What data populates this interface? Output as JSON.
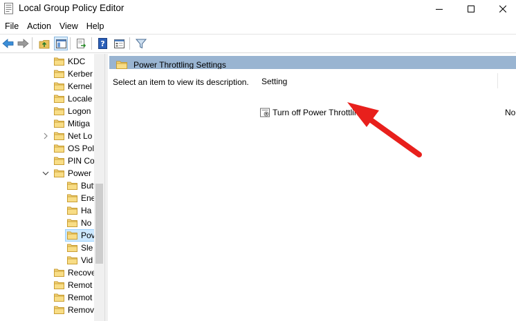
{
  "window": {
    "title": "Local Group Policy Editor",
    "icon": "policy-editor-icon",
    "controls": [
      "minimize-icon",
      "maximize-icon",
      "close-icon"
    ]
  },
  "menu": [
    "File",
    "Action",
    "View",
    "Help"
  ],
  "toolbar": [
    "back-arrow-icon",
    "forward-arrow-icon",
    "up-folder-icon",
    "show-hide-tree-icon",
    "export-list-icon",
    "help-icon",
    "properties-icon",
    "filter-icon"
  ],
  "tree": {
    "items": [
      {
        "label": "KDC",
        "expandable": false
      },
      {
        "label": "Kerber",
        "expandable": false
      },
      {
        "label": "Kernel",
        "expandable": false
      },
      {
        "label": "Locale",
        "expandable": false
      },
      {
        "label": "Logon",
        "expandable": false
      },
      {
        "label": "Mitiga",
        "expandable": false
      },
      {
        "label": "Net Lo",
        "expandable": true
      },
      {
        "label": "OS Pol",
        "expandable": false
      },
      {
        "label": "PIN Co",
        "expandable": false
      },
      {
        "label": "Power",
        "expanded": true
      },
      {
        "label": "Butt",
        "child": true
      },
      {
        "label": "Ene",
        "child": true
      },
      {
        "label": "Ha",
        "child": true
      },
      {
        "label": "No",
        "child": true
      },
      {
        "label": "Pov",
        "child": true,
        "selected": true
      },
      {
        "label": "Sle",
        "child": true
      },
      {
        "label": "Vid",
        "child": true
      },
      {
        "label": "Recove",
        "expandable": false
      },
      {
        "label": "Remot",
        "expandable": false
      },
      {
        "label": "Remot",
        "expandable": false
      },
      {
        "label": "Remov",
        "expandable": false
      }
    ]
  },
  "right": {
    "header": "Power Throttling Settings",
    "description": "Select an item to view its description.",
    "column": "Setting",
    "settings": [
      {
        "name": "Turn off Power Throttling",
        "state": "No"
      }
    ]
  },
  "colors": {
    "header_bg": "#99b4d1",
    "selected_bg": "#cce8ff",
    "arrow": "#e8201c",
    "folder": "#e8c25c"
  }
}
